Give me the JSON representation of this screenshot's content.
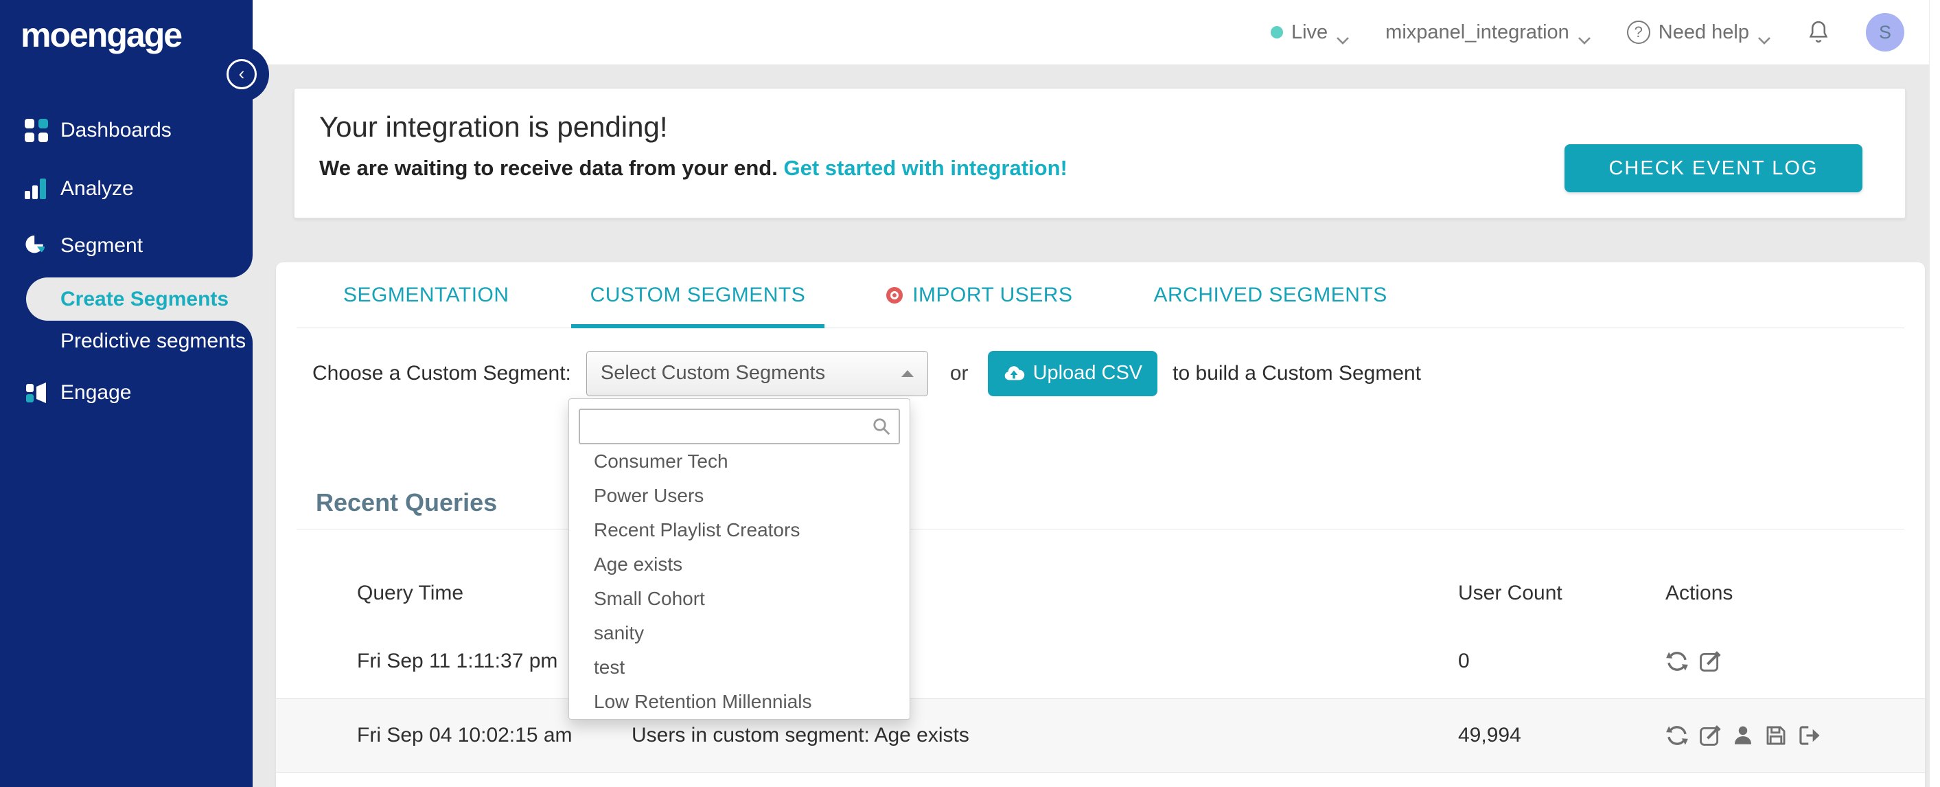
{
  "brand": {
    "logo": "moengage"
  },
  "sidebar": {
    "items": [
      {
        "label": "Dashboards",
        "icon": "dashboards-icon"
      },
      {
        "label": "Analyze",
        "icon": "analyze-icon"
      },
      {
        "label": "Segment",
        "icon": "segment-icon"
      },
      {
        "label": "Create Segments",
        "active": true
      },
      {
        "label": "Predictive segments"
      },
      {
        "label": "Engage",
        "icon": "engage-icon"
      }
    ],
    "collapse_glyph": "‹"
  },
  "topbar": {
    "env_label": "Live",
    "project_name": "mixpanel_integration",
    "help_label": "Need help",
    "help_glyph": "?",
    "avatar_initial": "S"
  },
  "banner": {
    "title": "Your integration is pending!",
    "message": "We are waiting to receive data from your end.",
    "link": "Get started with integration!",
    "button": "CHECK EVENT LOG"
  },
  "tabs": [
    {
      "label": "SEGMENTATION"
    },
    {
      "label": "CUSTOM SEGMENTS",
      "active": true
    },
    {
      "label": "IMPORT USERS",
      "icon": "record-dot-icon"
    },
    {
      "label": "ARCHIVED SEGMENTS"
    }
  ],
  "segment_picker": {
    "label": "Choose a Custom Segment:",
    "select_value": "Select Custom Segments",
    "or_text": "or",
    "upload_button": "Upload CSV",
    "suffix_text": "to build a Custom Segment",
    "search_value": "",
    "options": [
      "Consumer Tech",
      "Power Users",
      "Recent Playlist Creators",
      "Age exists",
      "Small Cohort",
      "sanity",
      "test",
      "Low Retention Millennials"
    ]
  },
  "recent_queries": {
    "title": "Recent Queries",
    "columns": [
      "Query Time",
      "",
      "User Count",
      "Actions"
    ],
    "rows": [
      {
        "time": "Fri Sep 11 1:11:37 pm",
        "query": "",
        "user_count": "0",
        "actions": [
          "refresh",
          "edit"
        ]
      },
      {
        "time": "Fri Sep 04 10:02:15 am",
        "query": "Users in custom segment: Age exists",
        "user_count": "49,994",
        "actions": [
          "refresh",
          "edit",
          "user",
          "save",
          "export"
        ]
      }
    ]
  },
  "colors": {
    "accent_teal": "#12a3b8",
    "sidebar_navy": "#0e2878",
    "link_teal": "#16b0c4",
    "live_dot": "#5fd0c4",
    "avatar_bg": "#a9b2f3",
    "import_dot_red": "#e25b5b",
    "recent_queries_title": "#5b7a8c"
  }
}
